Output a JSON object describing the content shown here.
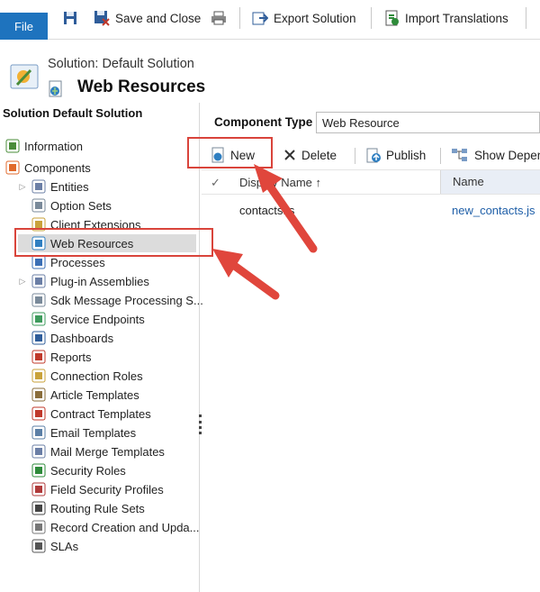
{
  "ribbon": {
    "file": "File",
    "save_close": "Save and Close",
    "export_solution": "Export Solution",
    "import_translations": "Import Translations"
  },
  "header": {
    "subtitle": "Solution: Default Solution",
    "title": "Web Resources"
  },
  "nav": {
    "heading": "Solution Default Solution",
    "items": [
      {
        "label": "Information",
        "icon": "information-icon"
      },
      {
        "label": "Components",
        "icon": "components-icon"
      },
      {
        "label": "Entities",
        "icon": "entities-icon"
      },
      {
        "label": "Option Sets",
        "icon": "option-sets-icon"
      },
      {
        "label": "Client Extensions",
        "icon": "client-extensions-icon"
      },
      {
        "label": "Web Resources",
        "icon": "web-resource-icon"
      },
      {
        "label": "Processes",
        "icon": "processes-icon"
      },
      {
        "label": "Plug-in Assemblies",
        "icon": "plugin-icon"
      },
      {
        "label": "Sdk Message Processing S...",
        "icon": "sdk-message-icon"
      },
      {
        "label": "Service Endpoints",
        "icon": "service-endpoints-icon"
      },
      {
        "label": "Dashboards",
        "icon": "dashboards-icon"
      },
      {
        "label": "Reports",
        "icon": "reports-icon"
      },
      {
        "label": "Connection Roles",
        "icon": "connection-roles-icon"
      },
      {
        "label": "Article Templates",
        "icon": "article-templates-icon"
      },
      {
        "label": "Contract Templates",
        "icon": "contract-templates-icon"
      },
      {
        "label": "Email Templates",
        "icon": "email-templates-icon"
      },
      {
        "label": "Mail Merge Templates",
        "icon": "mail-merge-icon"
      },
      {
        "label": "Security Roles",
        "icon": "security-roles-icon"
      },
      {
        "label": "Field Security Profiles",
        "icon": "field-security-icon"
      },
      {
        "label": "Routing Rule Sets",
        "icon": "routing-rule-icon"
      },
      {
        "label": "Record Creation and Upda...",
        "icon": "record-creation-icon"
      },
      {
        "label": "SLAs",
        "icon": "sla-icon"
      }
    ]
  },
  "main": {
    "component_type_label": "Component Type",
    "component_type_value": "Web Resource",
    "toolbar": {
      "new": "New",
      "delete": "Delete",
      "publish": "Publish",
      "show_dependencies": "Show Depen"
    },
    "grid": {
      "col_display_name": "Display Name ↑",
      "col_name": "Name",
      "rows": [
        {
          "display_name": "contacts.js",
          "name": "new_contacts.js"
        }
      ]
    }
  },
  "colors": {
    "accent": "#1e73be",
    "highlight": "#d9443b",
    "link": "#1f5fa8"
  }
}
